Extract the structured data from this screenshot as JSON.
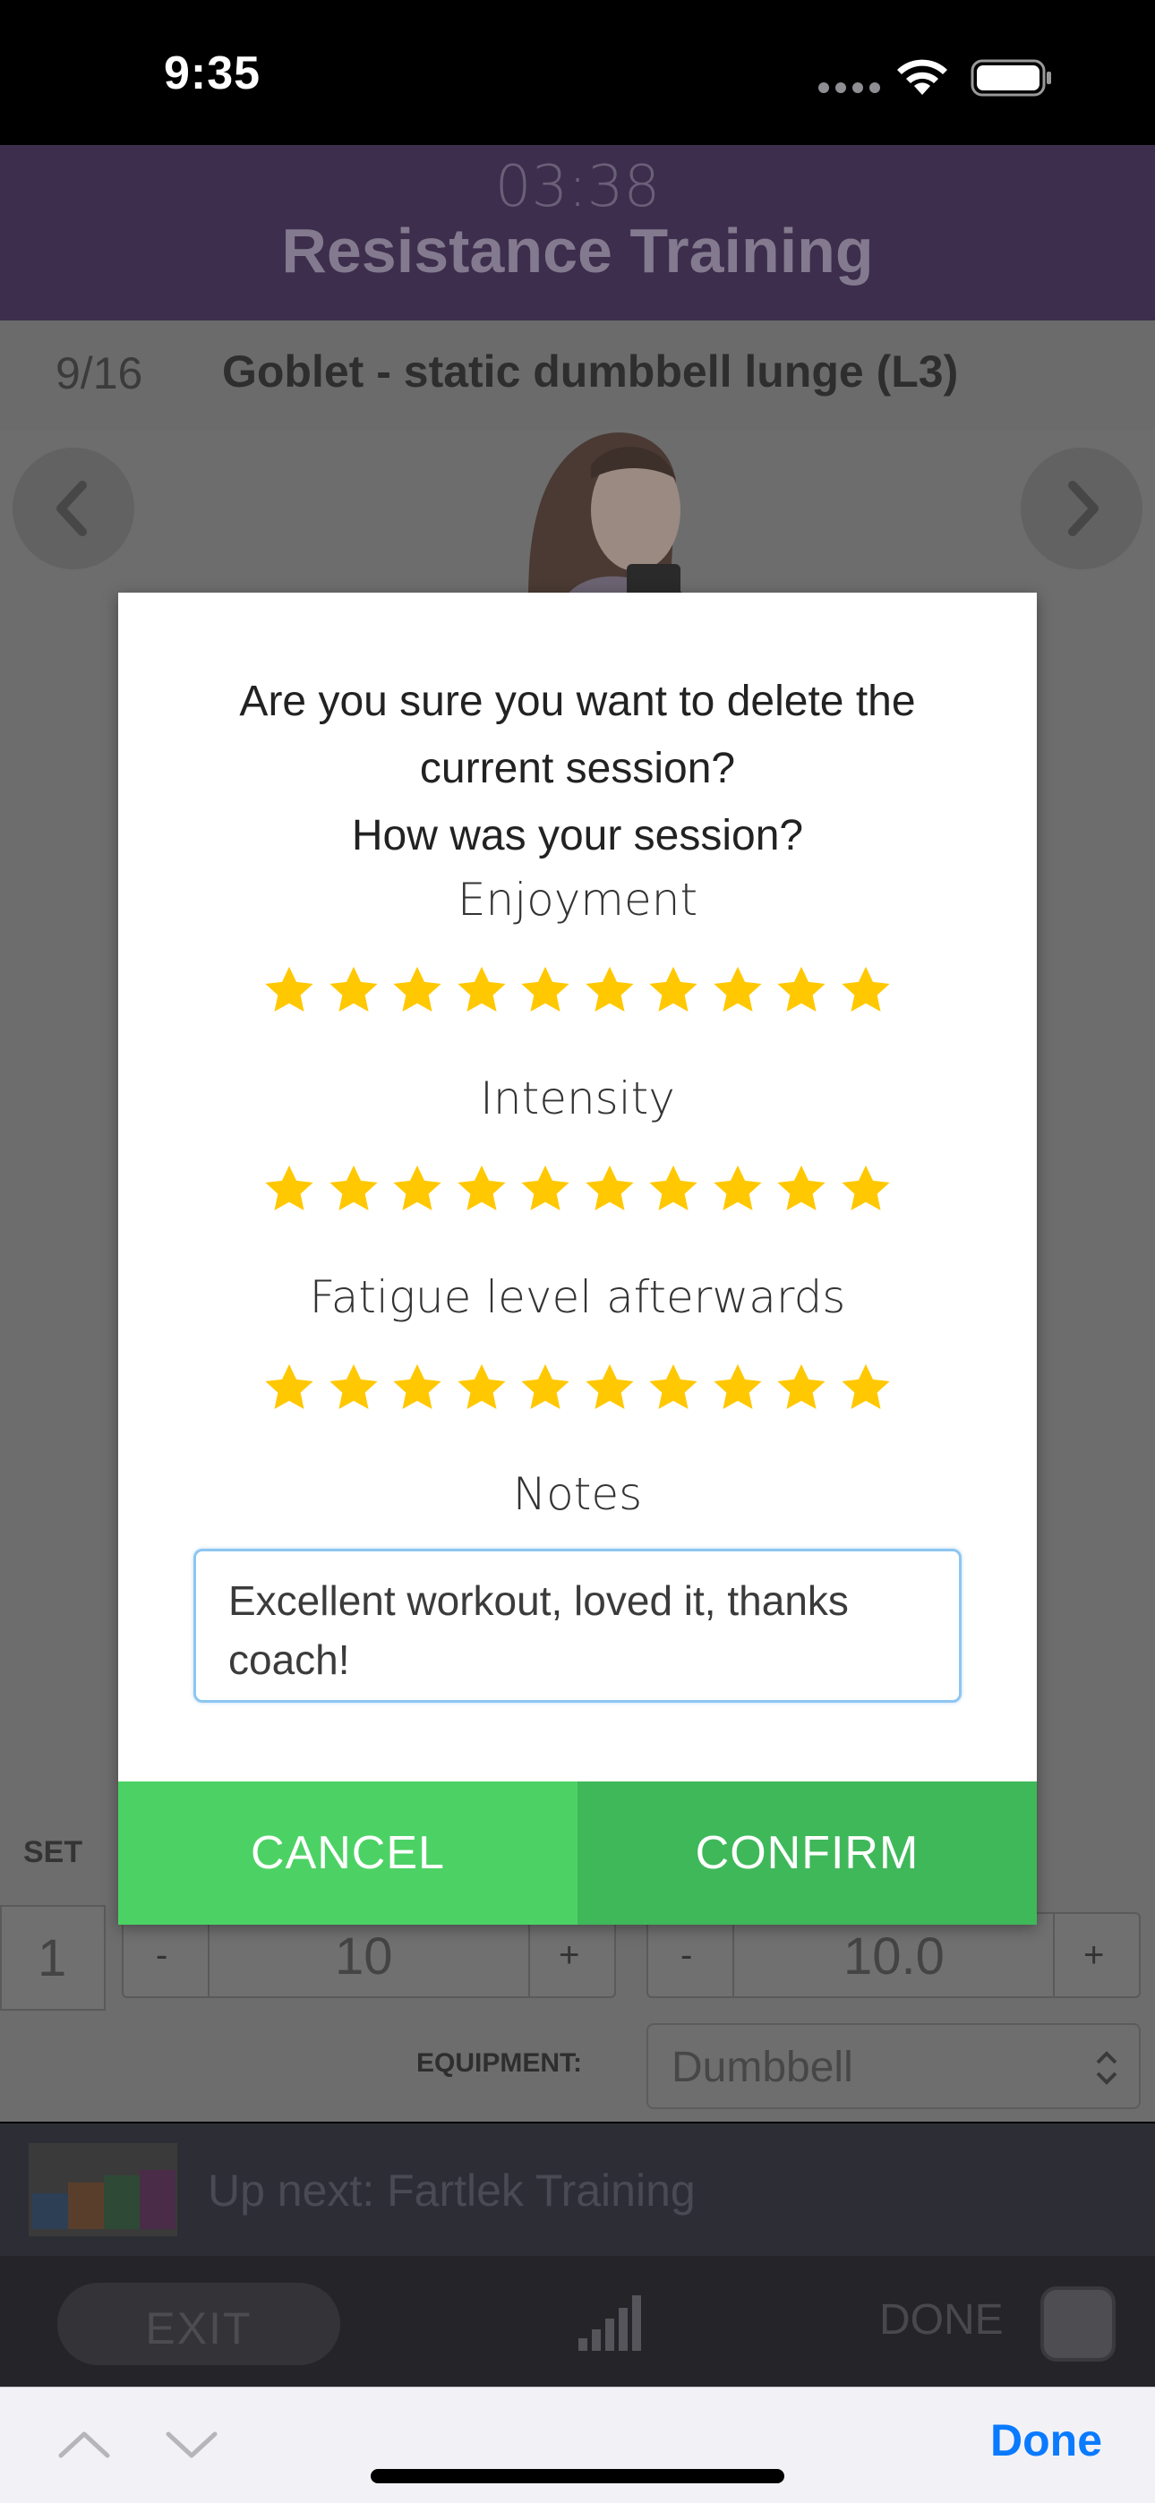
{
  "status_bar": {
    "time": "9:35"
  },
  "header": {
    "timer": "03:38",
    "title": "Resistance Training"
  },
  "exercise": {
    "count": "9/16",
    "name": "Goblet - static dumbbell lunge (L3)"
  },
  "sets_table": {
    "set_header": "SET",
    "set_number": "1",
    "reps_minus": "-",
    "reps_value": "10",
    "reps_plus": "+",
    "weight_minus": "-",
    "weight_value": "10.0",
    "weight_plus": "+",
    "equipment_label": "EQUIPMENT:",
    "equipment_value": "Dumbbell"
  },
  "up_next": {
    "text": "Up next: Fartlek Training"
  },
  "footer": {
    "exit_label": "EXIT",
    "done_label": "DONE"
  },
  "keyboard_bar": {
    "done_label": "Done"
  },
  "dialog": {
    "question_line1": "Are you sure you want to delete the",
    "question_line2": "current session?",
    "question_line3": "How was your session?",
    "ratings": [
      {
        "label": "Enjoyment",
        "stars": 10,
        "max": 10
      },
      {
        "label": "Intensity",
        "stars": 10,
        "max": 10
      },
      {
        "label": "Fatigue level afterwards",
        "stars": 10,
        "max": 10
      }
    ],
    "notes_label": "Notes",
    "notes_value": "Excellent workout, loved it, thanks coach!",
    "cancel_label": "CANCEL",
    "confirm_label": "CONFIRM"
  },
  "colors": {
    "header_bg": "#3c2e4c",
    "star": "#ffc800",
    "cancel_bg": "#4cd264",
    "confirm_bg": "#3fb85a",
    "accent_blue": "#0a7aff"
  },
  "icons": [
    "wifi-icon",
    "battery-icon",
    "cellular-dots-icon",
    "chevron-left-icon",
    "chevron-right-icon",
    "star-icon",
    "signal-bars-icon",
    "chevron-up-icon",
    "chevron-down-icon",
    "select-arrows-icon"
  ]
}
